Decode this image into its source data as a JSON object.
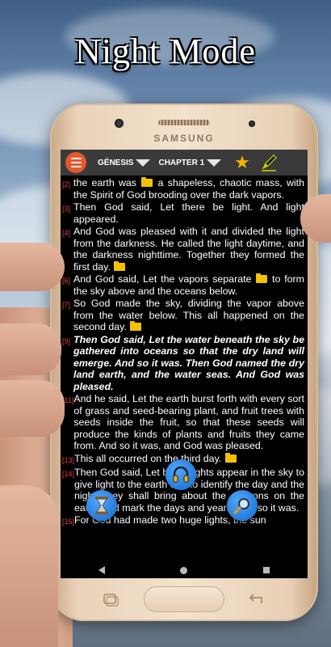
{
  "promo_title": "Night Mode",
  "phone_brand": "SAMSUNG",
  "toolbar": {
    "book": "GÉNESIS",
    "chapter": "CHAPTER 1"
  },
  "verses": [
    {
      "num": "[2]",
      "parts": [
        "the earth was ",
        "folder",
        " a shapeless, chaotic mass, with the Spirit of God brooding over the dark vapors."
      ],
      "highlight": false
    },
    {
      "num": "[3]",
      "parts": [
        "Then God said, Let there be light. And light appeared."
      ],
      "highlight": false
    },
    {
      "num": "[4]",
      "parts": [
        "And God was pleased with it and divided the light from the darkness. He called the light daytime, and the darkness nighttime. Together they formed the first day. ",
        "folder"
      ],
      "highlight": false
    },
    {
      "num": "[6]",
      "parts": [
        "And God said, Let the vapors separate ",
        "folder",
        " to form the sky above and the oceans below."
      ],
      "highlight": false
    },
    {
      "num": "[7]",
      "parts": [
        "So God made the sky, dividing the vapor above from the water below. This all happened on the second day. ",
        "folder"
      ],
      "highlight": false
    },
    {
      "num": "[9]",
      "parts": [
        "Then God said, Let the water beneath the sky be gathered into oceans so that the dry land will emerge. And so it was. Then God named the dry land earth, and the water seas. And God was pleased."
      ],
      "highlight": true
    },
    {
      "num": "[11]",
      "parts": [
        "And he said, Let the earth burst forth with every sort of grass and seed-bearing plant, and fruit trees with seeds inside the fruit, so that these seeds will produce the kinds of plants and fruits they came from. And so it was, and God was pleased."
      ],
      "highlight": false
    },
    {
      "num": "[13]",
      "parts": [
        "This all occurred on the third day. ",
        "folder"
      ],
      "highlight": false
    },
    {
      "num": "[14]",
      "parts": [
        "Then God said, Let bright lights appear in the sky to give light to the earth and to identify the day and the night; they shall bring about the seasons on the earth, and mark the days and years. And so it was."
      ],
      "highlight": false
    },
    {
      "num": "[15]",
      "parts": [
        "For God had made two huge lights, the sun"
      ],
      "highlight": false
    }
  ],
  "icons": {
    "menu": "menu-icon",
    "favorite": "star-icon",
    "edit": "pen-icon",
    "audio": "headphones-icon",
    "timer": "hourglass-icon",
    "search": "search-icon"
  },
  "colors": {
    "menu_button": "#e8572b",
    "verse_number": "#e04040",
    "star": "#f5b400",
    "fab": "#1268c8"
  }
}
